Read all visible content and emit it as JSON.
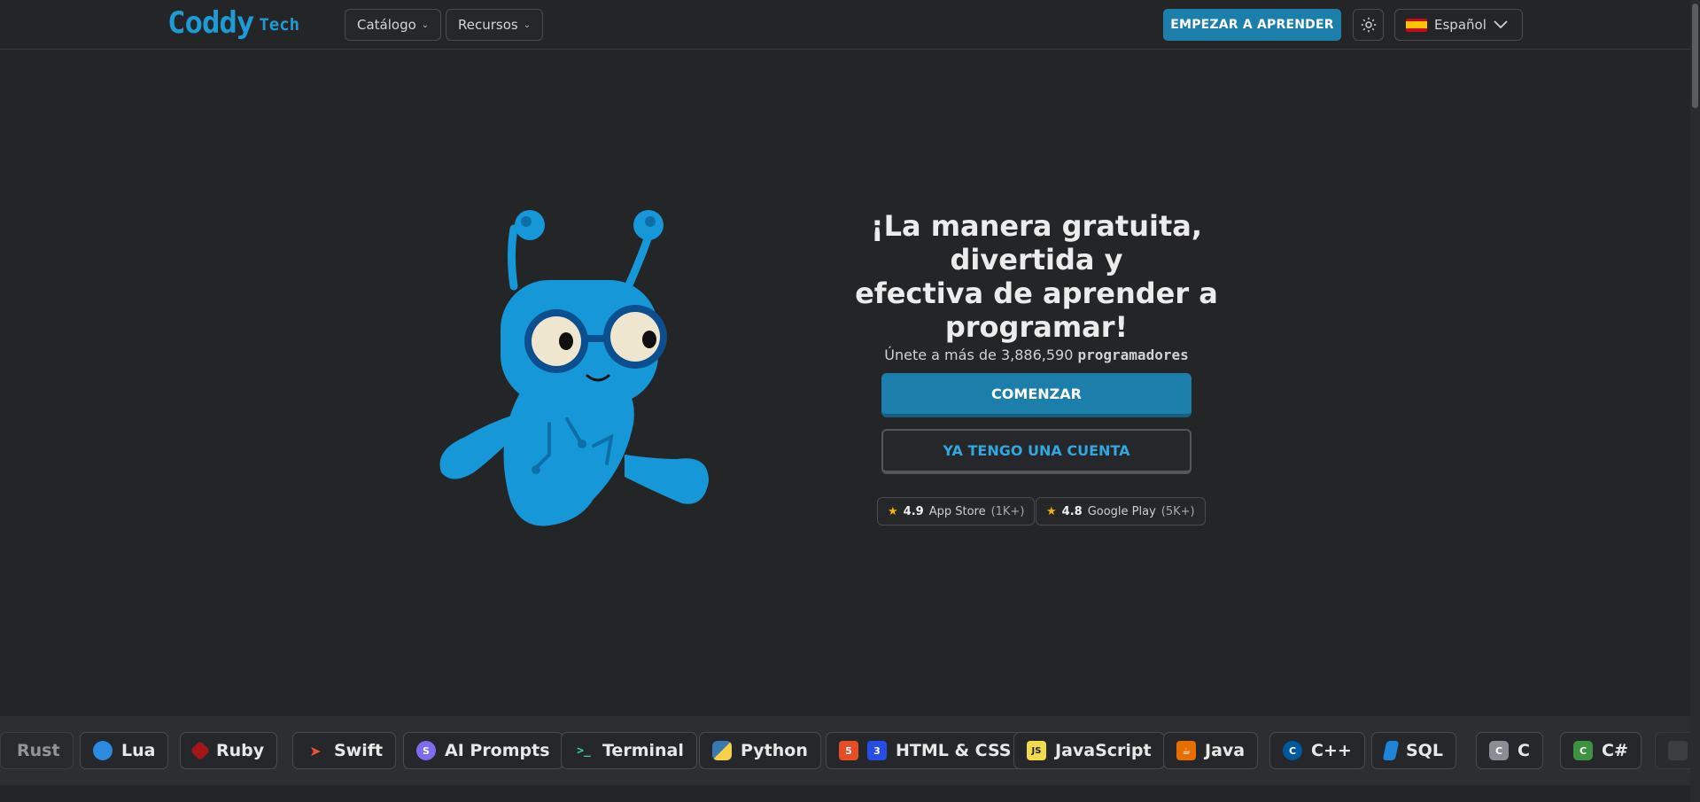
{
  "header": {
    "logo_main": "Coddy",
    "logo_sub": "Tech",
    "nav": [
      {
        "label": "Catálogo"
      },
      {
        "label": "Recursos"
      }
    ],
    "cta_label": "EMPEZAR A APRENDER",
    "language": "Español"
  },
  "hero": {
    "title_line1": "¡La manera gratuita, divertida y",
    "title_line2": "efectiva de aprender a",
    "title_line3": "programar!",
    "join_prefix": "Únete a más de",
    "join_count": "3,886,590",
    "join_suffix": "programadores",
    "start_label": "COMENZAR",
    "account_label": "YA TENGO UNA CUENTA",
    "ratings": [
      {
        "score": "4.9",
        "store": "App Store",
        "count": "(1K+)"
      },
      {
        "score": "4.8",
        "store": "Google Play",
        "count": "(5K+)"
      }
    ]
  },
  "languages": [
    {
      "label": "Rust",
      "icon": "rust-icon",
      "color": "#3a3b3e"
    },
    {
      "label": "Lua",
      "icon": "lua-icon",
      "color": "#2c8be0"
    },
    {
      "label": "Ruby",
      "icon": "ruby-icon",
      "color": "#a3161a"
    },
    {
      "label": "Swift",
      "icon": "swift-icon",
      "color": "#f05138"
    },
    {
      "label": "AI Prompts",
      "icon": "ai-prompts-icon",
      "color": "#7b6cf0"
    },
    {
      "label": "Terminal",
      "icon": "terminal-icon",
      "color": "#2a2b2d"
    },
    {
      "label": "Python",
      "icon": "python-icon",
      "color": "#3b78b0"
    },
    {
      "label": "HTML & CSS",
      "icon": "html-css-icon",
      "color": "#e44d26"
    },
    {
      "label": "JavaScript",
      "icon": "javascript-icon",
      "color": "#f0db4f"
    },
    {
      "label": "Java",
      "icon": "java-icon",
      "color": "#e76f00"
    },
    {
      "label": "C++",
      "icon": "cpp-icon",
      "color": "#00599c"
    },
    {
      "label": "SQL",
      "icon": "sql-icon",
      "color": "#1f84d6"
    },
    {
      "label": "C",
      "icon": "c-icon",
      "color": "#8a8d93"
    },
    {
      "label": "C#",
      "icon": "csharp-icon",
      "color": "#3f9142"
    }
  ]
}
